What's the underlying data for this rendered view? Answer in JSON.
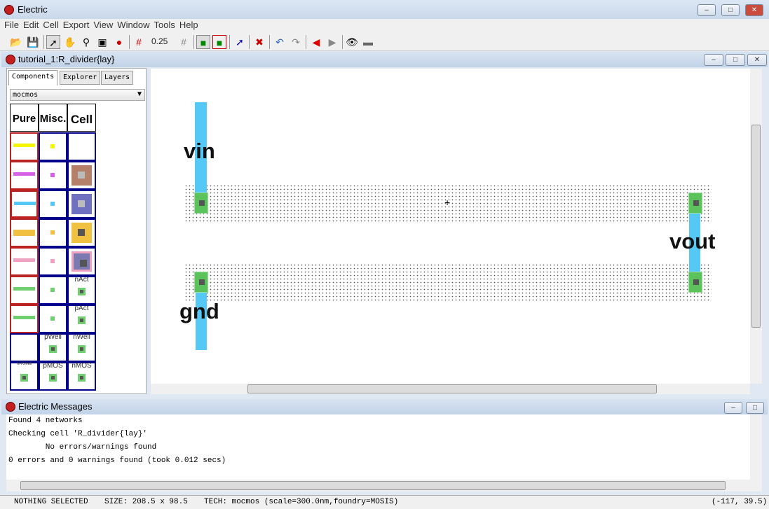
{
  "app": {
    "title": "Electric"
  },
  "menu": [
    "File",
    "Edit",
    "Cell",
    "Export",
    "View",
    "Window",
    "Tools",
    "Help"
  ],
  "toolbar": {
    "grid_value": "0.25"
  },
  "document": {
    "title": "tutorial_1:R_divider{lay}"
  },
  "left_panel": {
    "tabs": [
      "Components",
      "Explorer",
      "Layers"
    ],
    "technology": "mocmos",
    "headers": [
      "Pure",
      "Misc.",
      "Cell"
    ],
    "labels": {
      "nact": "nAct",
      "pact": "pAct",
      "pwell": "pWell",
      "nwell": "nWell",
      "nrwell": "N-RWell",
      "pmos": "pMOS",
      "nmos": "nMOS"
    }
  },
  "layout": {
    "labels": {
      "vin": "vin",
      "vout": "vout",
      "gnd": "gnd"
    }
  },
  "messages": {
    "title": "Electric Messages",
    "lines": [
      "Found 4 networks",
      "Checking cell 'R_divider{lay}'",
      "        No errors/warnings found",
      "0 errors and 0 warnings found (took 0.012 secs)"
    ]
  },
  "status": {
    "selection": "NOTHING SELECTED",
    "size": "SIZE: 208.5 x 98.5",
    "tech": "TECH: mocmos (scale=300.0nm,foundry=MOSIS)",
    "coords": "(-117, 39.5)"
  }
}
